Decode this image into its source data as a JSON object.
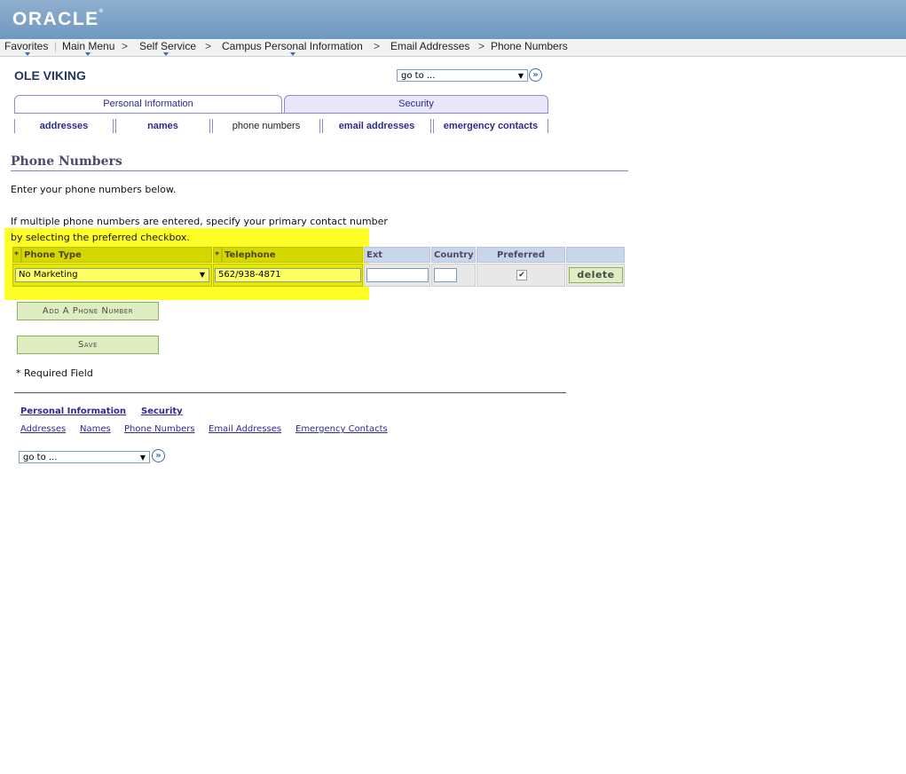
{
  "app": {
    "brand": "ORACLE"
  },
  "nav": {
    "favorites": "Favorites",
    "main_menu": "Main Menu",
    "self_service": "Self Service",
    "campus_personal_info": "Campus Personal Information",
    "email_addresses": "Email Addresses",
    "phone_numbers": "Phone Numbers",
    "separator": ">"
  },
  "person_name": "OLE VIKING",
  "goto": {
    "label": "go to ..."
  },
  "tabs": [
    {
      "label": "Personal Information",
      "active": true
    },
    {
      "label": "Security",
      "active": false
    }
  ],
  "subtabs": [
    {
      "label": "addresses"
    },
    {
      "label": "names"
    },
    {
      "label": "phone numbers",
      "active": true
    },
    {
      "label": "email addresses"
    },
    {
      "label": "emergency contacts"
    }
  ],
  "page": {
    "title": "Phone Numbers",
    "instruction1": "Enter your phone numbers below.",
    "instruction2a": "If multiple phone numbers are entered, specify your primary contact number",
    "instruction2b": "by selecting the preferred checkbox."
  },
  "grid": {
    "columns": {
      "required_marker": "*",
      "phone_type": "Phone Type",
      "telephone": "Telephone",
      "ext": "Ext",
      "country": "Country",
      "preferred": "Preferred"
    },
    "rows": [
      {
        "phone_type": "No Marketing",
        "telephone": "562/938-4871",
        "ext": "",
        "country": "",
        "preferred": true
      }
    ],
    "delete_label": "delete"
  },
  "buttons": {
    "add_phone": "Add A Phone Number",
    "save": "Save"
  },
  "required_note": "* Required Field",
  "footer": {
    "top_links": [
      "Personal Information",
      "Security"
    ],
    "links": [
      "Addresses",
      "Names",
      "Phone Numbers",
      "Email Addresses",
      "Emergency Contacts"
    ]
  },
  "colors": {
    "header": "#7ba0c5",
    "highlight": "#ffff00",
    "tab_text": "#2e2a8c",
    "button_bg": "#dfeec2"
  }
}
